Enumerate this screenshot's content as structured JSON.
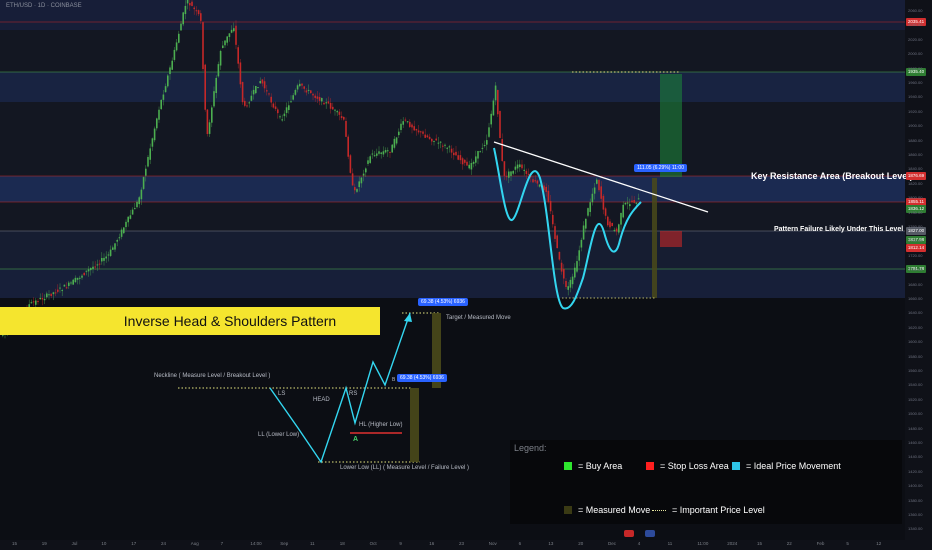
{
  "header": {
    "symbol_text": "ETH/USD · 1D · COINBASE"
  },
  "banner": {
    "title": "Inverse Head & Shoulders Pattern",
    "color": "#f5e52e"
  },
  "annotations": {
    "key_resistance": "Key Resistance Area (Breakout Level)",
    "pattern_failure": "Pattern Failure Likely Under This Level",
    "target": "Target / Measured Move",
    "neckline": "Neckline ( Measure Level / Breakout Level )",
    "ls": "LS",
    "head": "HEAD",
    "rs": "RS",
    "hl": "HL (Higher Low)",
    "ll": "LL (Lower Low)",
    "lower_low": "Lower Low (LL) ( Measure Level / Failure Level )",
    "point_a": "A",
    "point_b": "B"
  },
  "measure_tags": {
    "main": "111.05 (6.29%) 11:00",
    "schematic_top": "69.38 (4.53%) 6936",
    "schematic_mid": "69.38 (4.53%) 6936"
  },
  "price_tags": [
    {
      "label": "2035.41",
      "color": "#d32f2f"
    },
    {
      "label": "1935.40",
      "color": "#2e7d32"
    },
    {
      "label": "1876.69",
      "color": "#d32f2f"
    },
    {
      "label": "1855.11",
      "color": "#d32f2f"
    },
    {
      "label": "1836.12",
      "color": "#2e7d32"
    },
    {
      "label": "1827.00",
      "color": "#555a64"
    },
    {
      "label": "1817.98",
      "color": "#2e7d32"
    },
    {
      "label": "1812.14",
      "color": "#d32f2f"
    },
    {
      "label": "1791.78",
      "color": "#2e7d32"
    }
  ],
  "y_axis_ticks": [
    "2060.00",
    "2040.00",
    "2020.00",
    "2000.00",
    "1980.00",
    "1960.00",
    "1940.00",
    "1920.00",
    "1900.00",
    "1880.00",
    "1860.00",
    "1840.00",
    "1820.00",
    "1800.00",
    "1780.00",
    "1760.00",
    "1740.00",
    "1720.00",
    "1700.00",
    "1680.00",
    "1660.00",
    "1640.00",
    "1620.00",
    "1600.00",
    "1580.00",
    "1560.00",
    "1540.00",
    "1520.00",
    "1500.00",
    "1480.00",
    "1460.00",
    "1440.00",
    "1420.00",
    "1400.00",
    "1380.00",
    "1360.00",
    "1340.00"
  ],
  "x_axis_ticks": [
    "15",
    "19",
    "Jul",
    "10",
    "17",
    "24",
    "Aug",
    "7",
    "14:00",
    "Sep",
    "11",
    "18",
    "Oct",
    "9",
    "16",
    "23",
    "Nov",
    "6",
    "13",
    "20",
    "Dec",
    "4",
    "11",
    "11:00",
    "2024",
    "15",
    "22",
    "Feb",
    "5",
    "12"
  ],
  "legend": {
    "title": "Legend:",
    "buy": "= Buy Area",
    "stop": "= Stop Loss Area",
    "ideal": "= Ideal Price Movement",
    "measured": "= Measured Move",
    "important": "= Important Price Level",
    "colors": {
      "buy": "#2ee62e",
      "stop": "#ff1f1f",
      "ideal": "#2ec4e6",
      "measured": "#3a3a14"
    }
  },
  "colors": {
    "bull": "#4caf50",
    "bear": "#c62828",
    "ideal_path": "#33d6f0",
    "resistance_line": "#ffffff",
    "zone": "#2a3a6e"
  }
}
